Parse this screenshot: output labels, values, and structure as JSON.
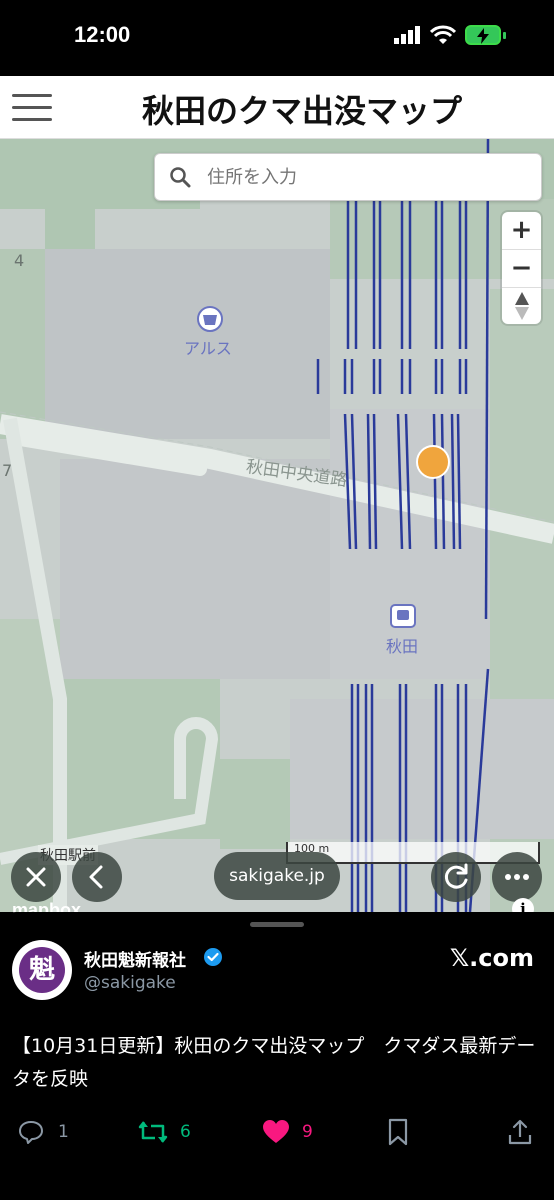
{
  "status_bar": {
    "time": "12:00"
  },
  "app": {
    "title": "秋田のクマ出没マップ"
  },
  "search": {
    "placeholder": "住所を入力"
  },
  "map": {
    "zoom_in": "+",
    "zoom_out": "−",
    "labels": {
      "store": "アルス",
      "road": "秋田中央道路",
      "station": "秋田",
      "station_front": "秋田駅前",
      "grid_number_top": "4",
      "grid_number_mid": "7"
    },
    "scale_text": "100 m",
    "attribution": "mapbox",
    "colors": {
      "bear_marker": "#f0a53d",
      "rail": "#2a3a9a"
    }
  },
  "browser": {
    "url": "sakigake.jp"
  },
  "post": {
    "account_name": "秋田魁新報社",
    "handle": "@sakigake",
    "source": "𝕏.com",
    "avatar_char": "魁",
    "text": "【10月31日更新】秋田のクマ出没マップ　クマダス最新データを反映",
    "replies": "1",
    "reposts": "6",
    "likes": "9"
  }
}
